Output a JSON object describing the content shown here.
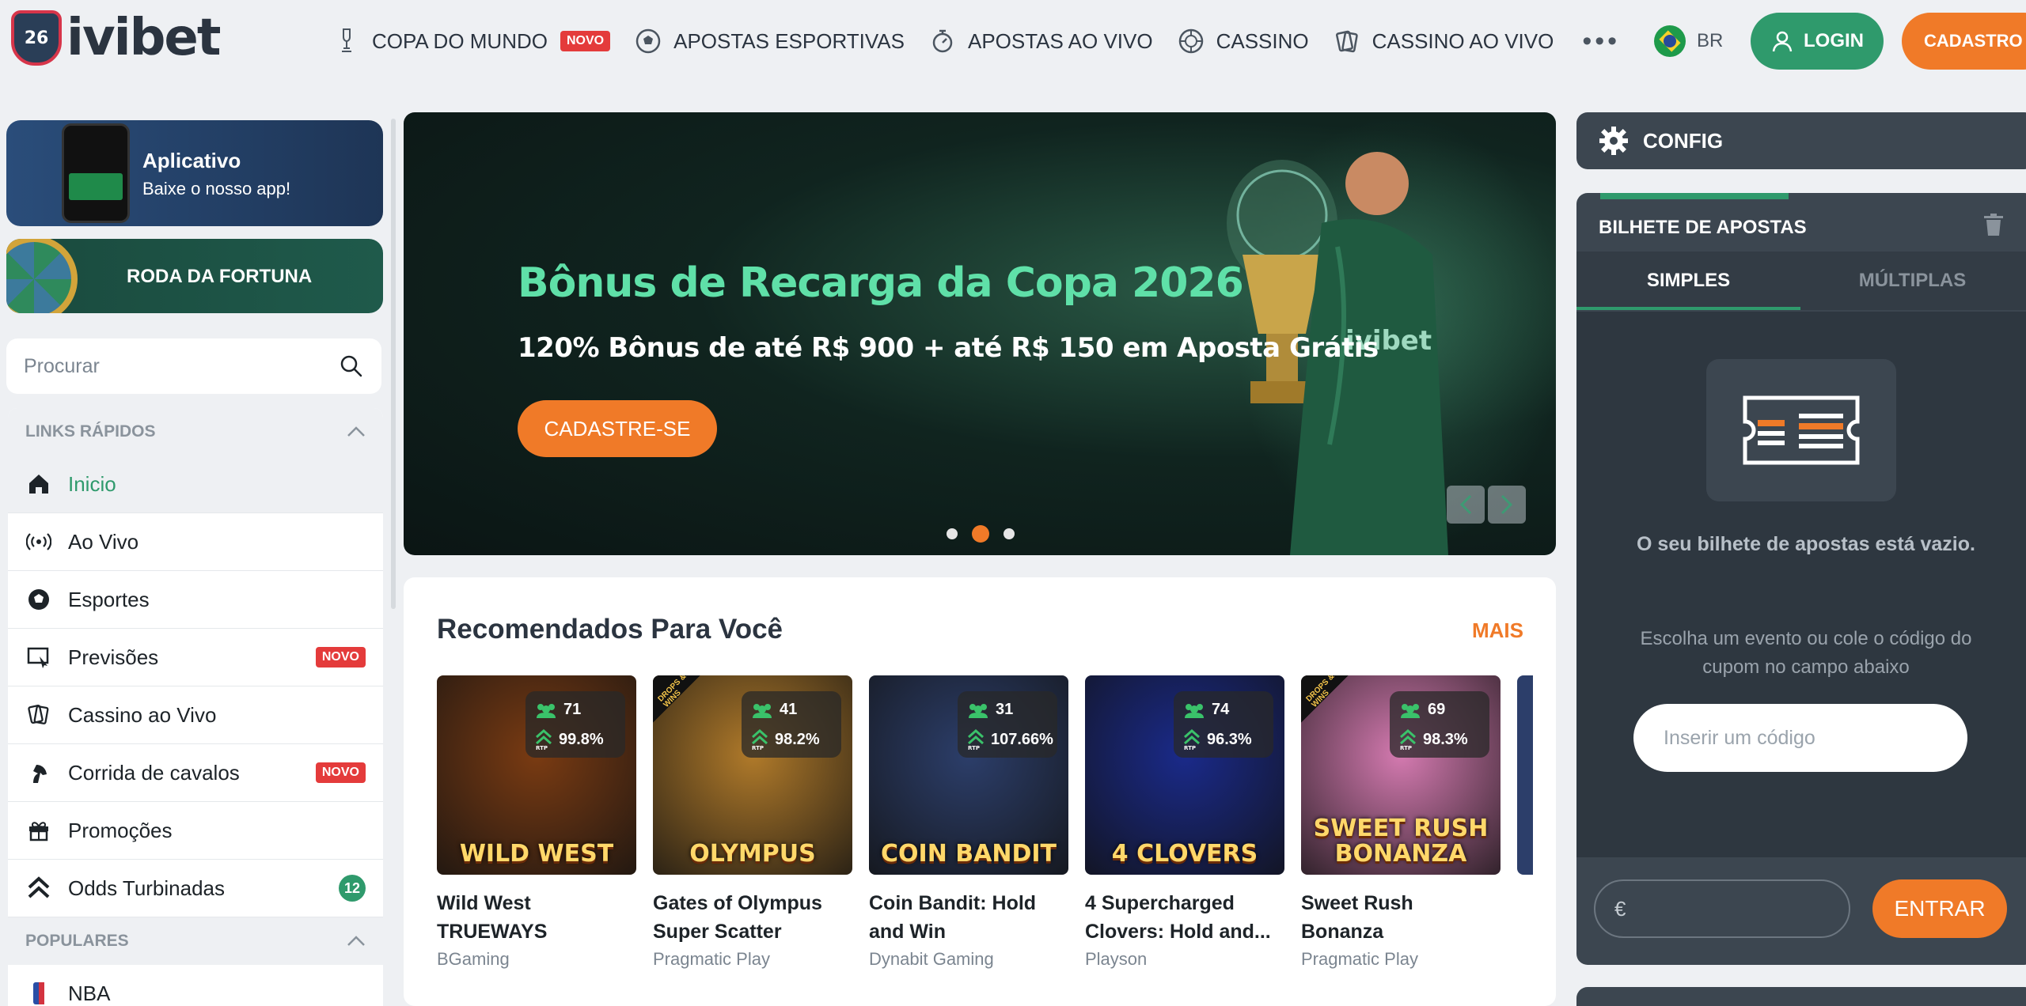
{
  "brand": {
    "name": "ivibet",
    "badge": "26"
  },
  "nav": {
    "items": [
      {
        "label": "COPA DO MUNDO",
        "icon": "trophy-icon",
        "badge": "NOVO"
      },
      {
        "label": "APOSTAS ESPORTIVAS",
        "icon": "soccer-ball-icon"
      },
      {
        "label": "APOSTAS AO VIVO",
        "icon": "stopwatch-icon"
      },
      {
        "label": "CASSINO",
        "icon": "roulette-icon"
      },
      {
        "label": "CASSINO AO VIVO",
        "icon": "cards-icon"
      }
    ],
    "more": "•••"
  },
  "header": {
    "language": "BR",
    "login_label": "LOGIN",
    "register_label": "CADASTRO"
  },
  "sidebar": {
    "app_promo": {
      "title": "Aplicativo",
      "subtitle": "Baixe o nosso app!"
    },
    "wheel_promo": {
      "title": "RODA DA FORTUNA"
    },
    "search": {
      "placeholder": "Procurar"
    },
    "quick_links": {
      "title": "LINKS RÁPIDOS",
      "items": [
        {
          "label": "Inicio",
          "icon": "home-icon",
          "active": true
        },
        {
          "label": "Ao Vivo",
          "icon": "broadcast-icon"
        },
        {
          "label": "Esportes",
          "icon": "soccer-ball-icon"
        },
        {
          "label": "Previsões",
          "icon": "prediction-icon",
          "badge": "NOVO"
        },
        {
          "label": "Cassino ao Vivo",
          "icon": "cards-icon"
        },
        {
          "label": "Corrida de cavalos",
          "icon": "horse-icon",
          "badge": "NOVO"
        },
        {
          "label": "Promoções",
          "icon": "gift-icon"
        },
        {
          "label": "Odds Turbinadas",
          "icon": "boost-icon",
          "count": "12"
        }
      ]
    },
    "popular": {
      "title": "POPULARES",
      "items": [
        {
          "label": "NBA",
          "icon": "nba-icon"
        }
      ]
    }
  },
  "banner": {
    "title": "Bônus de Recarga da Copa 2026",
    "subtitle": "120% Bônus de até R$ 900 + até R$ 150 em Aposta Grátis",
    "cta": "CADASTRE-SE",
    "watermark": "ivibet",
    "slides": 3,
    "active_slide": 2
  },
  "recommended": {
    "title": "Recomendados Para Você",
    "more": "MAIS",
    "games": [
      {
        "name": "Wild West TRUEWAYS",
        "provider": "BGaming",
        "players": "71",
        "rtp": "99.8%",
        "art": "WILD WEST",
        "drops": false,
        "bg": "#7a3b12"
      },
      {
        "name": "Gates of Olympus Super Scatter",
        "provider": "Pragmatic Play",
        "players": "41",
        "rtp": "98.2%",
        "art": "OLYMPUS",
        "drops": true,
        "bg": "#b07a2a"
      },
      {
        "name": "Coin Bandit: Hold and Win",
        "provider": "Dynabit Gaming",
        "players": "31",
        "rtp": "107.66%",
        "art": "COIN BANDIT",
        "drops": false,
        "bg": "#2c3e6a"
      },
      {
        "name": "4 Supercharged Clovers: Hold and...",
        "provider": "Playson",
        "players": "74",
        "rtp": "96.3%",
        "art": "4 CLOVERS",
        "drops": false,
        "bg": "#1a2a8a"
      },
      {
        "name": "Sweet Rush Bonanza",
        "provider": "Pragmatic Play",
        "players": "69",
        "rtp": "98.3%",
        "art": "SWEET RUSH BONANZA",
        "drops": true,
        "bg": "#d47ab0"
      }
    ],
    "rtp_label": "RTP",
    "drops_label": "DROPS & WINS"
  },
  "betslip": {
    "config_label": "CONFIG",
    "title": "BILHETE DE APOSTAS",
    "tabs": [
      "SIMPLES",
      "MÚLTIPLAS"
    ],
    "empty_title": "O seu bilhete de apostas está vazio.",
    "empty_text": "Escolha um evento ou cole o código do cupom no campo abaixo",
    "coupon_placeholder": "Inserir um código",
    "currency": "€",
    "submit_label": "ENTRAR"
  },
  "colors": {
    "accent_green": "#2f9a6c",
    "accent_orange": "#f07a28",
    "badge_red": "#e43b3b",
    "panel_dark": "#3c4650"
  }
}
